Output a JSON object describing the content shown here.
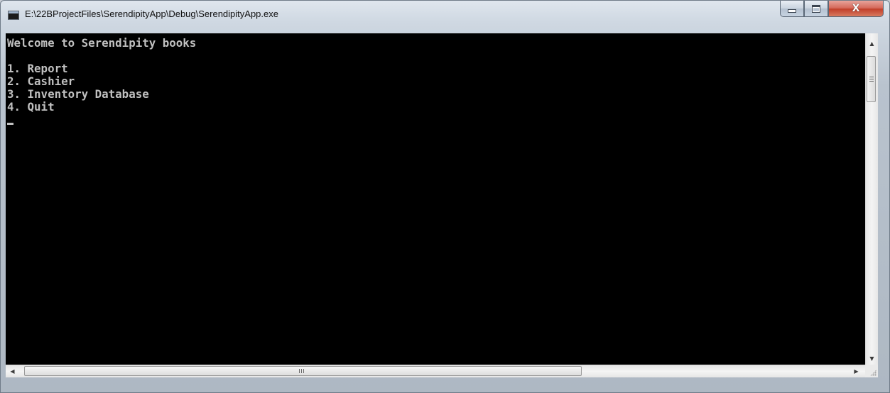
{
  "window": {
    "title": "E:\\22BProjectFiles\\SerendipityApp\\Debug\\SerendipityApp.exe",
    "close_glyph": "X"
  },
  "console": {
    "lines": [
      "Welcome to Serendipity books",
      "",
      "1. Report",
      "2. Cashier",
      "3. Inventory Database",
      "4. Quit"
    ],
    "foreground": "#c0c0c0",
    "background": "#000000"
  },
  "icons": {
    "app": "console-app-icon",
    "minimize": "minimize-icon",
    "maximize": "maximize-icon",
    "close": "close-icon",
    "scroll_up": "chevron-up-icon",
    "scroll_down": "chevron-down-icon",
    "scroll_left": "chevron-left-icon",
    "scroll_right": "chevron-right-icon"
  }
}
